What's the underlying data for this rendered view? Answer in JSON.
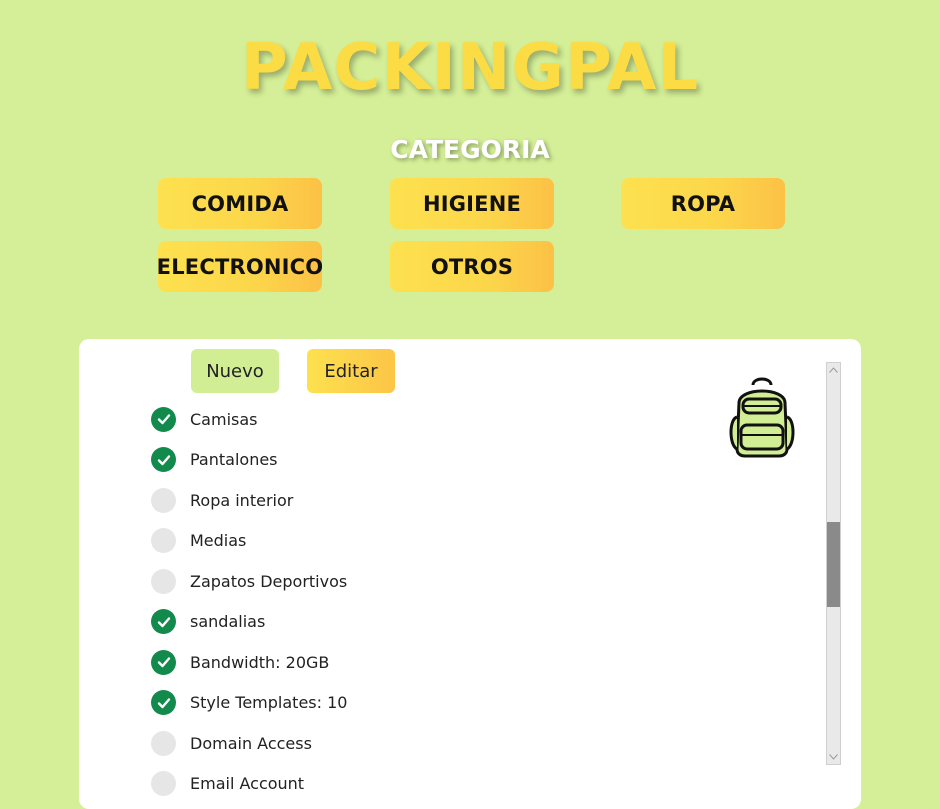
{
  "app": {
    "title": "PACKINGPAL"
  },
  "categories": {
    "heading": "CATEGORIA",
    "buttons": [
      {
        "label": "COMIDA"
      },
      {
        "label": "HIGIENE"
      },
      {
        "label": "ROPA"
      },
      {
        "label": "ELECTRONICO"
      },
      {
        "label": "OTROS"
      }
    ]
  },
  "panel": {
    "new_label": "Nuevo",
    "edit_label": "Editar",
    "items": [
      {
        "label": "Camisas",
        "checked": true
      },
      {
        "label": "Pantalones",
        "checked": true
      },
      {
        "label": "Ropa interior",
        "checked": false
      },
      {
        "label": "Medias",
        "checked": false
      },
      {
        "label": "Zapatos Deportivos",
        "checked": false
      },
      {
        "label": "sandalias",
        "checked": true
      },
      {
        "label": "Bandwidth: 20GB",
        "checked": true
      },
      {
        "label": "Style Templates: 10",
        "checked": true
      },
      {
        "label": "Domain Access",
        "checked": false
      },
      {
        "label": "Email Account",
        "checked": false
      }
    ]
  },
  "icons": {
    "backpack": "backpack-icon",
    "check": "check-icon"
  },
  "colors": {
    "background": "#d4ef97",
    "accent_yellow": "#fcdc44",
    "check_green": "#128a4c",
    "unchecked_gray": "#e6e6e6"
  }
}
